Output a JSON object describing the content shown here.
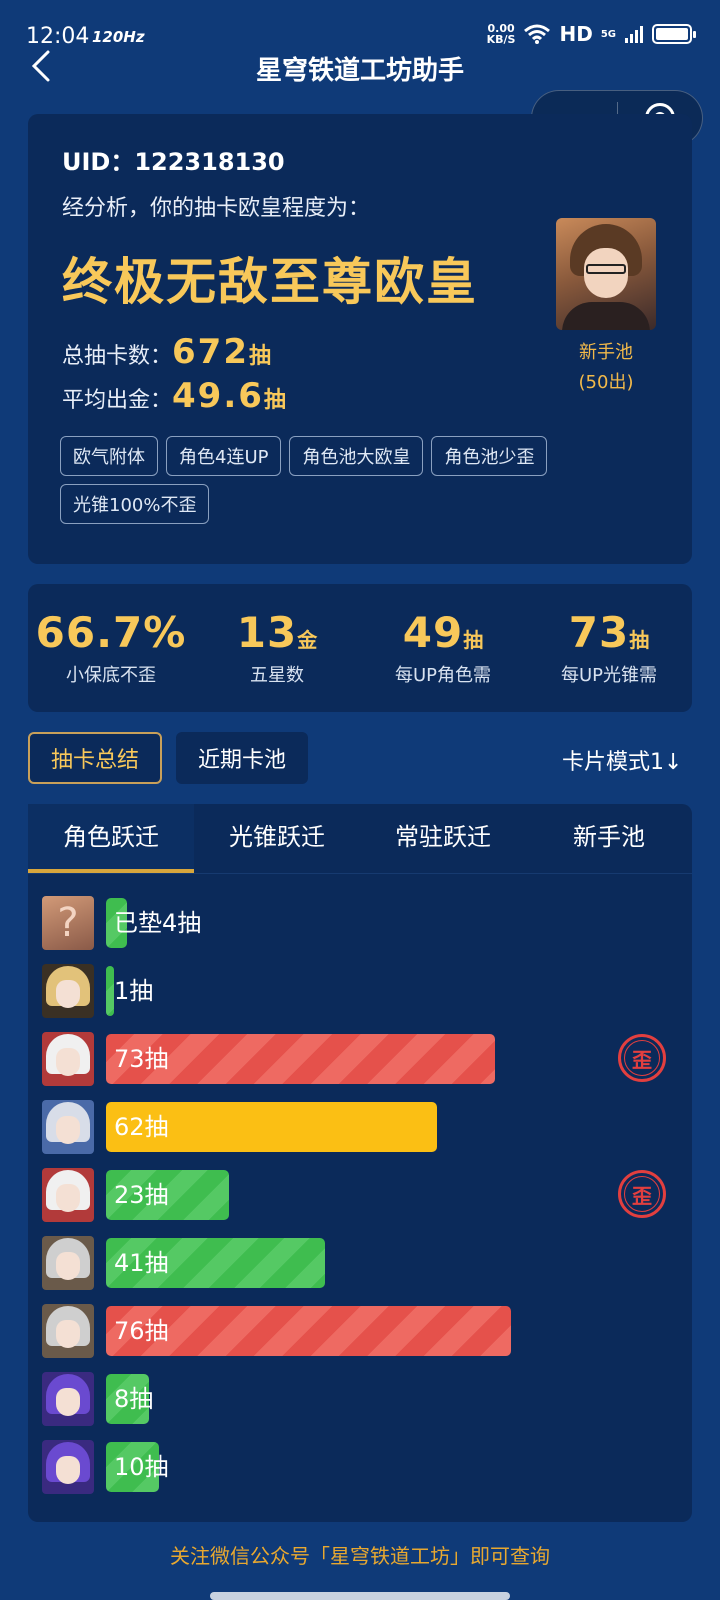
{
  "status": {
    "time": "12:04",
    "refresh": "120Hz",
    "net_speed": "0.00",
    "net_unit": "KB/S",
    "hd": "HD",
    "signal": "5G"
  },
  "header": {
    "title": "星穹铁道工坊助手"
  },
  "summary": {
    "uid": "UID：122318130",
    "analysis": "经分析，你的抽卡欧皇程度为：",
    "rank": "终极无敌至尊欧皇",
    "total_label": "总抽卡数：",
    "total_value": "672",
    "avg_label": "平均出金：",
    "avg_value": "49.6",
    "unit": "抽",
    "pool_name": "新手池",
    "pool_note": "(50出)",
    "tags": [
      "欧气附体",
      "角色4连UP",
      "角色池大欧皇",
      "角色池少歪",
      "光锥100%不歪"
    ]
  },
  "stats": [
    {
      "value": "66.7%",
      "unit": "",
      "caption": "小保底不歪"
    },
    {
      "value": "13",
      "unit": "金",
      "caption": "五星数"
    },
    {
      "value": "49",
      "unit": "抽",
      "caption": "每UP角色需"
    },
    {
      "value": "73",
      "unit": "抽",
      "caption": "每UP光锥需"
    }
  ],
  "modes": {
    "summary": "抽卡总结",
    "recent": "近期卡池",
    "card_mode": "卡片模式1↓"
  },
  "pool_tabs": [
    "角色跃迁",
    "光锥跃迁",
    "常驻跃迁",
    "新手池"
  ],
  "pull_rows": [
    {
      "label": "已垫4抽",
      "pulls": 4,
      "color": "green",
      "avatar": "unknown-avatar",
      "off_banner": false
    },
    {
      "label": "1抽",
      "pulls": 1,
      "color": "green",
      "avatar": "blonde-character-avatar",
      "off_banner": false
    },
    {
      "label": "73抽",
      "pulls": 73,
      "color": "red",
      "avatar": "white-hair-character-avatar",
      "off_banner": true
    },
    {
      "label": "62抽",
      "pulls": 62,
      "color": "yellow",
      "avatar": "silver-blue-character-avatar",
      "off_banner": false
    },
    {
      "label": "23抽",
      "pulls": 23,
      "color": "green",
      "avatar": "white-hair-character-avatar",
      "off_banner": true
    },
    {
      "label": "41抽",
      "pulls": 41,
      "color": "green",
      "avatar": "silver-character-avatar",
      "off_banner": false
    },
    {
      "label": "76抽",
      "pulls": 76,
      "color": "red",
      "avatar": "silver-character-avatar",
      "off_banner": false
    },
    {
      "label": "8抽",
      "pulls": 8,
      "color": "green",
      "avatar": "purple-hair-character-avatar",
      "off_banner": false
    },
    {
      "label": "10抽",
      "pulls": 10,
      "color": "green",
      "avatar": "purple-hair-character-avatar",
      "off_banner": false
    }
  ],
  "off_banner_mark": "歪",
  "footer": "关注微信公众号「星穹铁道工坊」即可查询"
}
